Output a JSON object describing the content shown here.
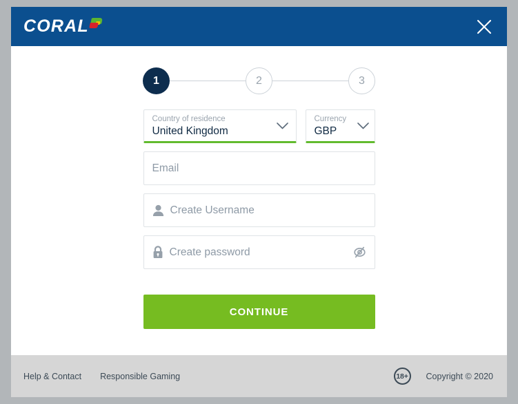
{
  "theme": {
    "header_blue": "#0b4f8f",
    "step_navy": "#0d2d4e",
    "accent_green": "#76bc21",
    "valid_green": "#62bb2e",
    "page_background": "#b2b6b9",
    "footer_background": "#d6d6d6"
  },
  "header": {
    "brand_text": "CORAL",
    "flag_icon": "coral-flag-icon",
    "close_icon": "close-icon"
  },
  "stepper": {
    "steps": [
      {
        "label": "1",
        "state": "active"
      },
      {
        "label": "2",
        "state": "inactive"
      },
      {
        "label": "3",
        "state": "inactive"
      }
    ]
  },
  "form": {
    "country": {
      "label": "Country of residence",
      "value": "United Kingdom",
      "chevron_icon": "chevron-down-icon"
    },
    "currency": {
      "label": "Currency",
      "value": "GBP",
      "chevron_icon": "chevron-down-icon"
    },
    "email": {
      "placeholder": "Email",
      "value": ""
    },
    "username": {
      "placeholder": "Create Username",
      "value": "",
      "icon": "user-icon"
    },
    "password": {
      "placeholder": "Create password",
      "value": "",
      "icon": "lock-icon",
      "toggle_icon": "eye-slash-icon"
    },
    "submit_label": "CONTINUE"
  },
  "footer": {
    "links": [
      {
        "label": "Help & Contact"
      },
      {
        "label": "Responsible Gaming"
      }
    ],
    "age_badge": "18+",
    "copyright": "Copyright © 2020"
  }
}
